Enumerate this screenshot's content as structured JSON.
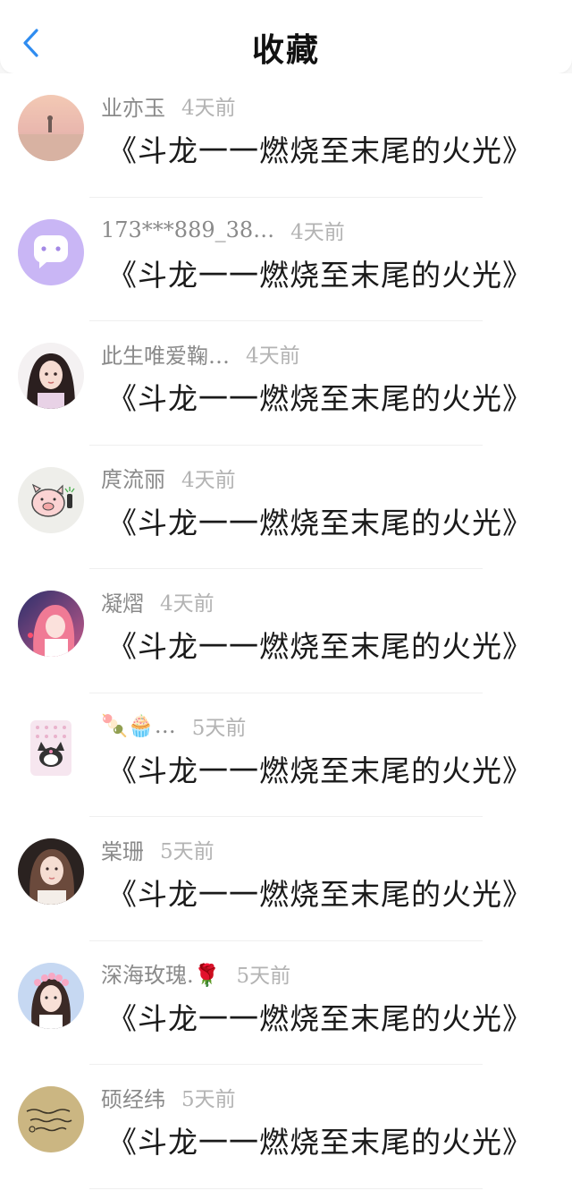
{
  "header": {
    "title": "收藏",
    "back_icon": "chevron-left-icon",
    "accent_color": "#2f8cf0"
  },
  "favorites": [
    {
      "username": "业亦玉",
      "time": "4天前",
      "book_title": "《斗龙一一燃烧至末尾的火光》",
      "avatar": "beach-photo-avatar"
    },
    {
      "username": "173***889_38…",
      "time": "4天前",
      "book_title": "《斗龙一一燃烧至末尾的火光》",
      "avatar": "default-chat-avatar"
    },
    {
      "username": "此生唯爱鞠…",
      "time": "4天前",
      "book_title": "《斗龙一一燃烧至末尾的火光》",
      "avatar": "anime-girl-avatar"
    },
    {
      "username": "庹流丽",
      "time": "4天前",
      "book_title": "《斗龙一一燃烧至末尾的火光》",
      "avatar": "cartoon-pig-avatar"
    },
    {
      "username": "凝熠",
      "time": "4天前",
      "book_title": "《斗龙一一燃烧至末尾的火光》",
      "avatar": "anime-pink-hair-avatar"
    },
    {
      "username": "🍡🧁…",
      "time": "5天前",
      "book_title": "《斗龙一一燃烧至末尾的火光》",
      "avatar": "kuromi-avatar"
    },
    {
      "username": "棠珊",
      "time": "5天前",
      "book_title": "《斗龙一一燃烧至末尾的火光》",
      "avatar": "girl-photo-avatar"
    },
    {
      "username": "深海玫瑰.🌹",
      "time": "5天前",
      "book_title": "《斗龙一一燃烧至末尾的火光》",
      "avatar": "flower-crown-girl-avatar"
    },
    {
      "username": "硕经纬",
      "time": "5天前",
      "book_title": "《斗龙一一燃烧至末尾的火光》",
      "avatar": "handwritten-note-avatar"
    }
  ]
}
